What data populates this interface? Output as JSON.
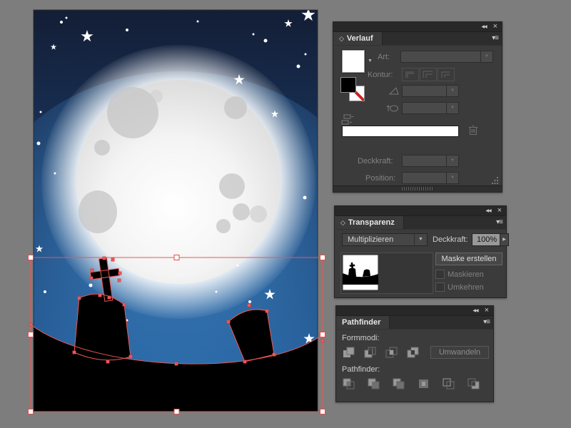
{
  "app": {
    "background_color": "#7d7d7d",
    "selection_color": "#ee5555",
    "artboard": {
      "scene": "night-sky-moon-graveyard-illustration"
    }
  },
  "icons": {
    "collapse": "◀◀",
    "close": "×",
    "panel_menu": "▾≡",
    "tab_toggle": "◇",
    "dropdown_arrow": "▼",
    "stepper_arrow": "▶",
    "swatch_arrow": "▼"
  },
  "panels": {
    "gradient": {
      "title": "Verlauf",
      "type_label": "Art:",
      "stroke_label": "Kontur:",
      "opacity_label": "Deckkraft:",
      "position_label": "Position:"
    },
    "transparency": {
      "title": "Transparenz",
      "blend_mode_value": "Multiplizieren",
      "opacity_label": "Deckkraft:",
      "opacity_value": "100%",
      "make_mask_button": "Maske erstellen",
      "clip_checkbox_label": "Maskieren",
      "invert_checkbox_label": "Umkehren"
    },
    "pathfinder": {
      "title": "Pathfinder",
      "shape_modes_label": "Formmodi:",
      "expand_button": "Umwandeln",
      "pathfinder_label": "Pathfinder:"
    }
  }
}
